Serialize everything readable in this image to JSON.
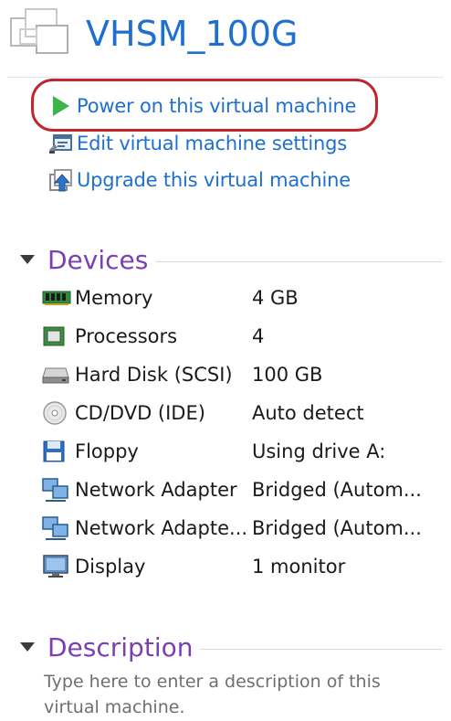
{
  "vm": {
    "title": "VHSM_100G"
  },
  "actions": [
    {
      "label": "Power on this virtual machine",
      "icon": "play-icon"
    },
    {
      "label": "Edit virtual machine settings",
      "icon": "settings-icon"
    },
    {
      "label": "Upgrade this virtual machine",
      "icon": "upgrade-icon"
    }
  ],
  "devices": {
    "title": "Devices",
    "items": [
      {
        "name": "Memory",
        "value": "4 GB",
        "icon": "memory-icon"
      },
      {
        "name": "Processors",
        "value": "4",
        "icon": "processor-icon"
      },
      {
        "name": "Hard Disk (SCSI)",
        "value": "100 GB",
        "icon": "hard-disk-icon"
      },
      {
        "name": "CD/DVD (IDE)",
        "value": "Auto detect",
        "icon": "cd-dvd-icon"
      },
      {
        "name": "Floppy",
        "value": "Using drive A:",
        "icon": "floppy-icon"
      },
      {
        "name": "Network Adapter",
        "value": "Bridged (Autom...",
        "icon": "network-adapter-icon"
      },
      {
        "name": "Network Adapte...",
        "value": "Bridged (Autom...",
        "icon": "network-adapter-icon"
      },
      {
        "name": "Display",
        "value": "1 monitor",
        "icon": "display-icon"
      }
    ]
  },
  "description": {
    "title": "Description",
    "placeholder": "Type here to enter a description of this virtual machine."
  },
  "colors": {
    "link_blue": "#1e6fd0",
    "section_purple": "#7b3fb3",
    "highlight_red": "#c0262e",
    "play_green": "#3bb54a"
  }
}
